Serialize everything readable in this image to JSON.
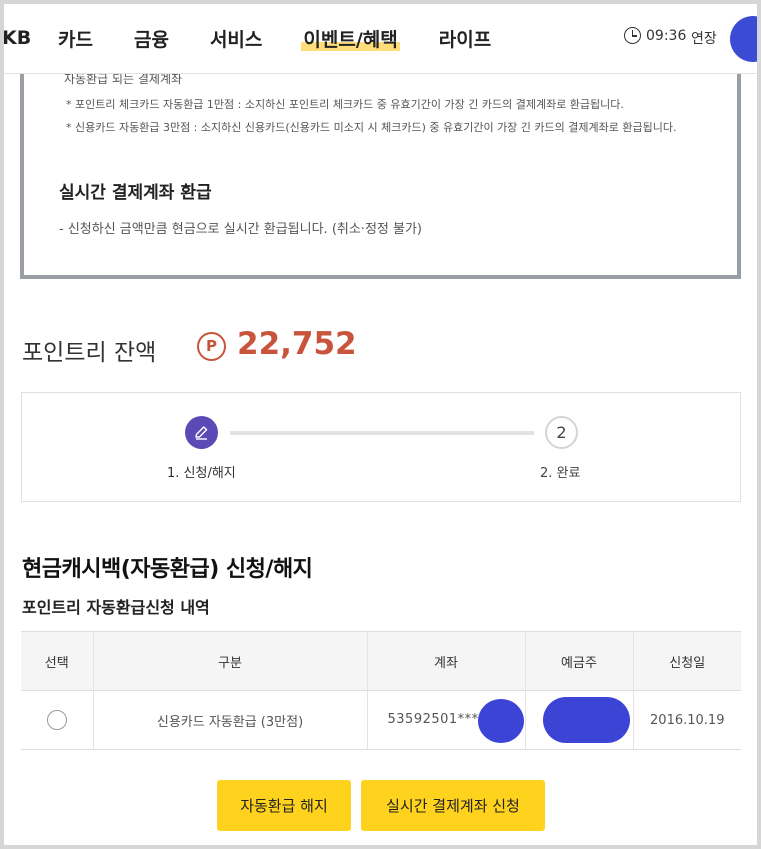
{
  "header": {
    "logo_fragment": "KB",
    "menu": [
      "카드",
      "금융",
      "서비스",
      "이벤트/혜택",
      "라이프"
    ],
    "active_menu": "이벤트/혜택",
    "session_time": "09:36",
    "extend_label": "연장"
  },
  "notice": {
    "cut_line": "자동환급 되는 결제계좌",
    "notes": [
      "* 포인트리 체크카드 자동환급 1만점 : 소지하신 포인트리 체크카드 중 유효기간이 가장 긴 카드의 결제계좌로 환급됩니다.",
      "* 신용카드 자동환급 3만점 : 소지하신 신용카드(신용카드 미소지 시 체크카드) 중 유효기간이 가장 긴 카드의 결제계좌로 환급됩니다."
    ],
    "heading": "실시간 결제계좌 환급",
    "desc": "- 신청하신 금액만큼 현금으로 실시간 환급됩니다. (취소·정정 불가)"
  },
  "balance": {
    "label": "포인트리 잔액",
    "icon_letter": "P",
    "value": "22,752"
  },
  "steps": {
    "step2_number": "2",
    "step1_label": "1. 신청/해지",
    "step2_label": "2. 완료"
  },
  "section": {
    "title": "현금캐시백(자동환급) 신청/해지",
    "subtitle": "포인트리 자동환급신청 내역"
  },
  "table": {
    "headers": [
      "선택",
      "구분",
      "계좌",
      "예금주",
      "신청일"
    ],
    "rows": [
      {
        "type": "신용카드 자동환급 (3만점)",
        "account": "53592501***",
        "holder": "",
        "date": "2016.10.19"
      }
    ]
  },
  "buttons": {
    "cancel": "자동환급 해지",
    "apply": "실시간 결제계좌 신청"
  },
  "colors": {
    "accent_yellow": "#ffd21d",
    "point_red": "#c8543b",
    "step_purple": "#5b49b5",
    "redaction_blue": "#3c44d6"
  }
}
